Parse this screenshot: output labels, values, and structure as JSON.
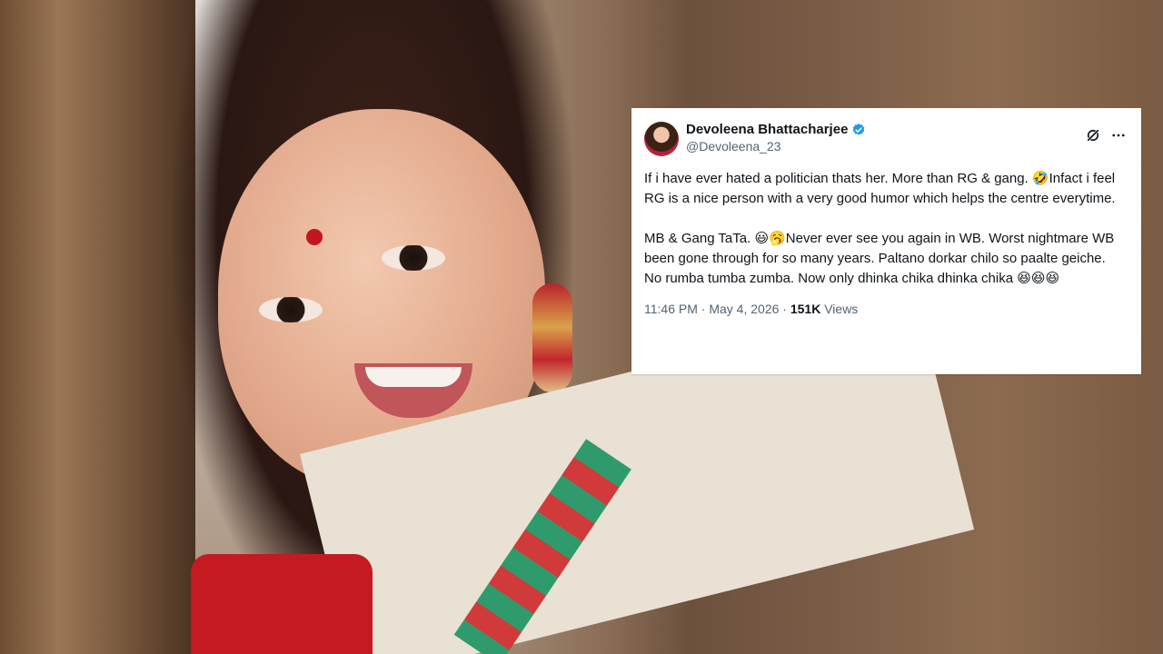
{
  "tweet": {
    "author": {
      "display_name": "Devoleena Bhattacharjee",
      "handle": "@Devoleena_23",
      "verified": true
    },
    "body": "If i have ever hated a politician thats her. More than RG & gang. 🤣Infact i feel RG is a nice person with a very good humor which helps the centre everytime.\n\nMB & Gang TaTa. 😃🥱Never ever see you again in WB. Worst nightmare WB been gone through for so many years. Paltano dorkar chilo so paalte geiche. No rumba tumba zumba. Now only dhinka chika dhinka chika 😆😆😆",
    "time": "11:46 PM",
    "separator": "·",
    "date": "May 4, 2026",
    "views_count": "151K",
    "views_label": "Views",
    "icons": [
      "grok-icon",
      "more-icon",
      "verified-badge-icon"
    ],
    "colors": {
      "text": "#0f1419",
      "muted": "#536471",
      "verified": "#1d9bf0"
    }
  }
}
